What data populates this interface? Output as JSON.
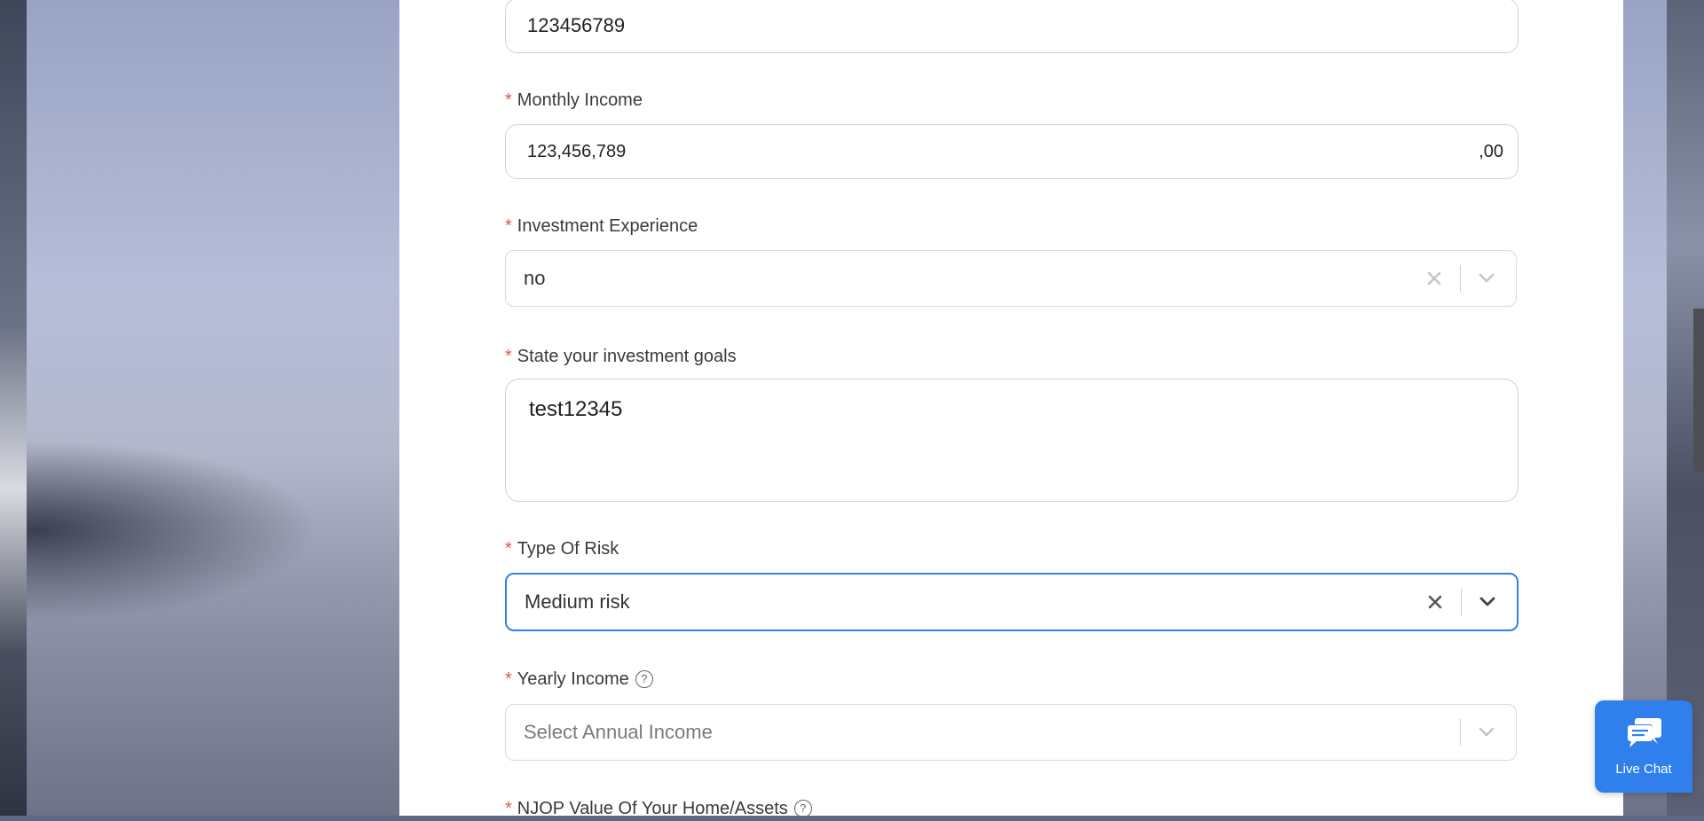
{
  "form": {
    "account_field": {
      "value": "123456789"
    },
    "monthly_income": {
      "label": "Monthly Income",
      "value": "123,456,789",
      "suffix": ",00"
    },
    "investment_experience": {
      "label": "Investment Experience",
      "value": "no"
    },
    "investment_goals": {
      "label": "State your investment goals",
      "value": "test12345"
    },
    "type_of_risk": {
      "label": "Type Of Risk",
      "value": "Medium risk"
    },
    "yearly_income": {
      "label": "Yearly Income",
      "placeholder": "Select Annual Income"
    },
    "njop_value": {
      "label": "NJOP Value Of Your Home/Assets"
    }
  },
  "required_marker": "*",
  "help_icon_glyph": "?",
  "live_chat": {
    "label": "Live Chat"
  },
  "colors": {
    "accent": "#2f80ed",
    "required": "#e5534b"
  }
}
